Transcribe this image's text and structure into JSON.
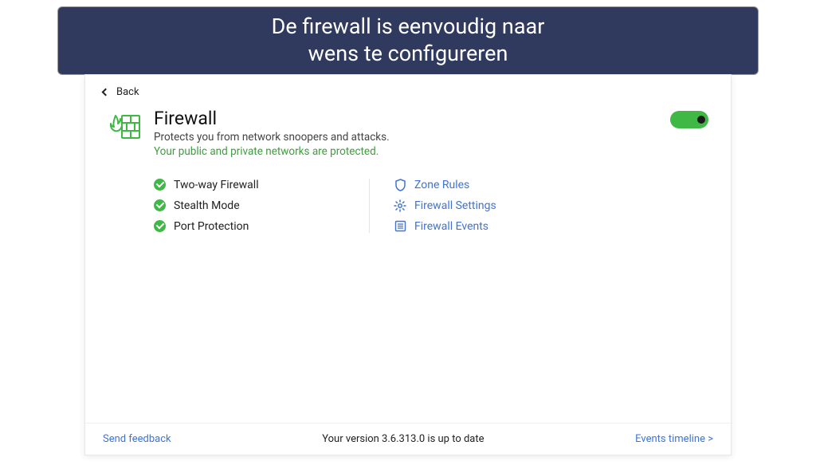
{
  "banner": {
    "line1": "De firewall is eenvoudig naar",
    "line2": "wens te configureren"
  },
  "nav": {
    "back": "Back"
  },
  "header": {
    "title": "Firewall",
    "subtitle": "Protects you from network snoopers and attacks.",
    "status": "Your public and private networks are protected.",
    "toggle_on": true
  },
  "features": [
    {
      "label": "Two-way Firewall"
    },
    {
      "label": "Stealth Mode"
    },
    {
      "label": "Port Protection"
    }
  ],
  "links": [
    {
      "icon": "shield-icon",
      "label": "Zone Rules"
    },
    {
      "icon": "gear-icon",
      "label": "Firewall Settings"
    },
    {
      "icon": "list-icon",
      "label": "Firewall Events"
    }
  ],
  "footer": {
    "feedback": "Send feedback",
    "version_text": "Your version 3.6.313.0 is up to date",
    "timeline": "Events timeline >"
  },
  "colors": {
    "banner_bg": "#303a5f",
    "link": "#3f74d4",
    "green": "#40b846",
    "status_green": "#3e9d3e"
  }
}
